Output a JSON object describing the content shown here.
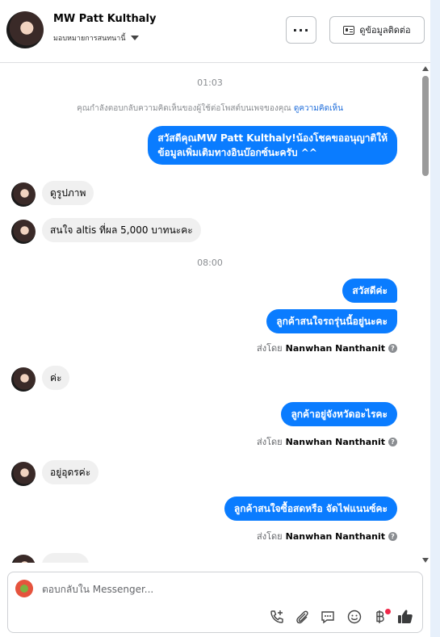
{
  "header": {
    "contact_name": "MW Patt Kulthaly",
    "assigned_to": "มอบหมายการสนทนานี้",
    "more_label": "···",
    "contact_info_label": "ดูข้อมูลติดต่อ"
  },
  "thread": {
    "timestamp_1": "01:03",
    "notice_text": "คุณกำลังตอบกลับความคิดเห็นของผู้ใช้ต่อโพสต์บนเพจของคุณ",
    "notice_link": "ดูความคิดเห็น",
    "msg_1_line1": "สวัสดีคุณMW Patt Kulthaly!น้องโชคขออนุญาติให้",
    "msg_1_line2": "ข้อมูลเพิ่มเติมทางอินบ๊อกซ์นะครับ ^^",
    "msg_2": "ดูรูปภาพ",
    "msg_3": "สนใจ altis ที่ผล 5,000 บาทนะคะ",
    "timestamp_2": "08:00",
    "msg_4": "สวัสดีค่ะ",
    "msg_5": "ลูกค้าสนใจรถรุ่นนี้อยู่นะคะ",
    "sent_by_prefix": "ส่งโดย",
    "sender": "Nanwhan Nanthanit",
    "msg_6": "ค่ะ",
    "msg_7": "ลูกค้าอยู่จังหวัดอะไรคะ",
    "msg_8": "อยู่อุดรค่ะ",
    "msg_9": "ลูกค้าสนใจซื้อสดหรือ จัดไฟแนนซ์คะ",
    "help_glyph": "?"
  },
  "composer": {
    "placeholder": "ตอบกลับใน Messenger..."
  },
  "colors": {
    "outgoing_bubble": "#0a7cff",
    "incoming_bubble": "#f0f0f0",
    "link": "#216fdb"
  }
}
